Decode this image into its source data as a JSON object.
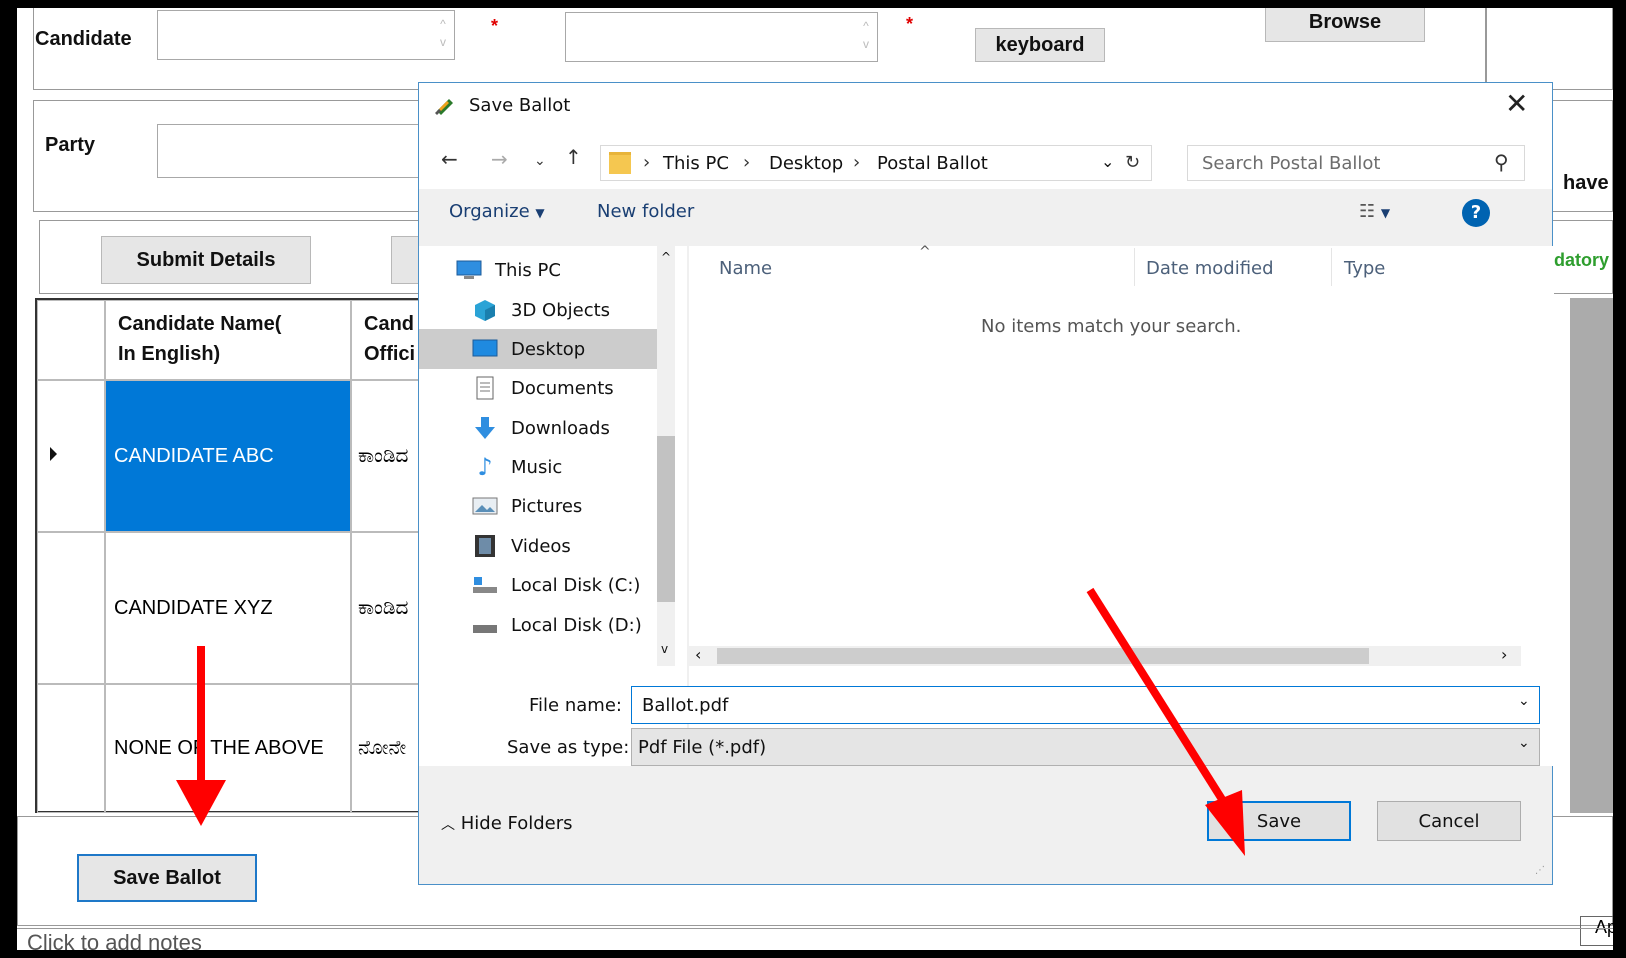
{
  "form": {
    "candidate_label": "Candidate",
    "party_label": "Party",
    "browse_label": "Browse",
    "keyboard_label": "keyboard",
    "submit_label": "Submit Details",
    "required_mark": "*",
    "right_partial_have": "have",
    "right_partial_mandatory": "datory",
    "save_ballot_label": "Save Ballot",
    "notes_placeholder": "Click to add notes",
    "bottom_right_partial": "Ap"
  },
  "grid": {
    "headers": [
      "Candidate Name( In English)",
      "Cand Offici"
    ],
    "header_line1": "Candidate Name(",
    "header_line2": "In English)",
    "header2_line1": "Cand",
    "header2_line2": "Offici",
    "rows": [
      {
        "name": "CANDIDATE ABC",
        "official": "ಕಾಂಡಿದ",
        "selected": true
      },
      {
        "name": "CANDIDATE XYZ",
        "official": "ಕಾಂಡಿದ",
        "selected": false
      },
      {
        "name": "NONE OF THE ABOVE",
        "official": "ನೋನೇ",
        "selected": false
      }
    ]
  },
  "dialog": {
    "title": "Save Ballot",
    "breadcrumb": [
      "This PC",
      "Desktop",
      "Postal Ballot"
    ],
    "search_placeholder": "Search Postal Ballot",
    "organize_label": "Organize",
    "new_folder_label": "New folder",
    "columns": [
      "Name",
      "Date modified",
      "Type"
    ],
    "empty_message": "No items match your search.",
    "nav_items": [
      {
        "label": "This PC",
        "icon": "this-pc-icon"
      },
      {
        "label": "3D Objects",
        "icon": "3d-objects-icon"
      },
      {
        "label": "Desktop",
        "icon": "desktop-icon",
        "selected": true
      },
      {
        "label": "Documents",
        "icon": "documents-icon"
      },
      {
        "label": "Downloads",
        "icon": "downloads-icon"
      },
      {
        "label": "Music",
        "icon": "music-icon"
      },
      {
        "label": "Pictures",
        "icon": "pictures-icon"
      },
      {
        "label": "Videos",
        "icon": "videos-icon"
      },
      {
        "label": "Local Disk (C:)",
        "icon": "local-disk-c-icon"
      },
      {
        "label": "Local Disk (D:)",
        "icon": "local-disk-d-icon"
      }
    ],
    "file_name_label": "File name:",
    "file_name_value": "Ballot.pdf",
    "save_as_type_label": "Save as type:",
    "save_as_type_value": "Pdf File (*.pdf)",
    "hide_folders_label": "Hide Folders",
    "save_label": "Save",
    "cancel_label": "Cancel"
  },
  "colors": {
    "selection_blue": "#0078d7",
    "annotation_red": "#ff0000",
    "mandatory_green": "#2e9e2e",
    "help_blue": "#0063b1"
  }
}
